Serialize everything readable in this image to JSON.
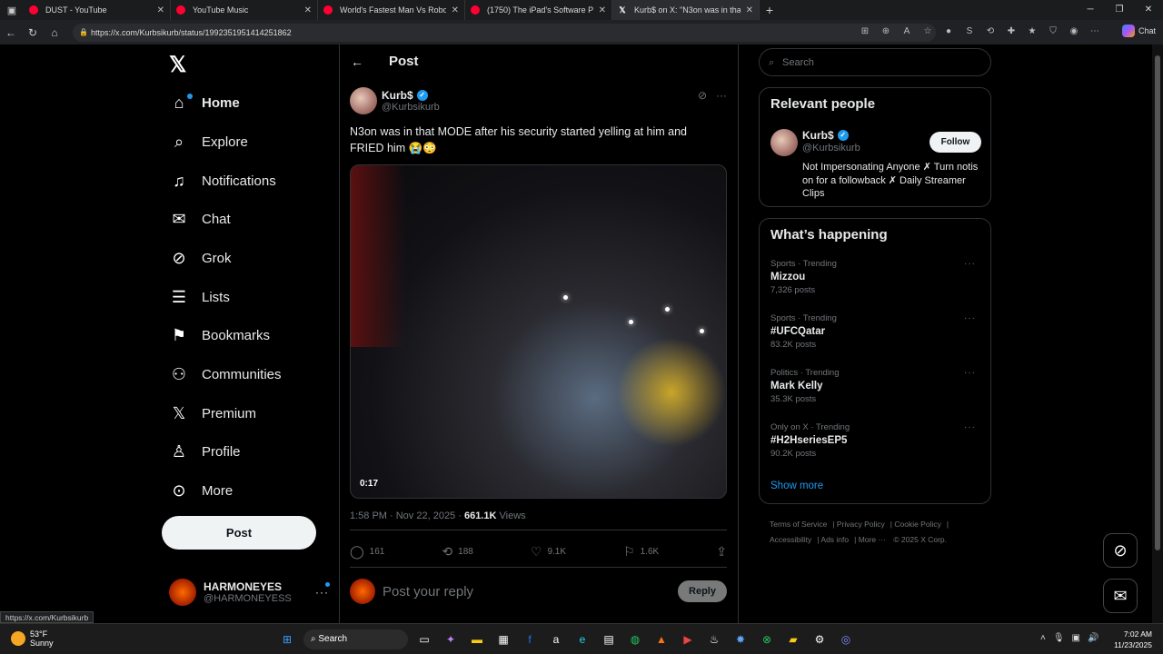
{
  "browser": {
    "tabs": [
      {
        "title": "DUST - YouTube",
        "active": false
      },
      {
        "title": "YouTube Music",
        "active": false
      },
      {
        "title": "World's Fastest Man Vs Robot! - Y",
        "active": false
      },
      {
        "title": "(1750) The iPad's Software Proble",
        "active": false
      },
      {
        "title": "Kurb$ on X: \"N3on was in that M",
        "active": true
      }
    ],
    "url": "https://x.com/Kurbsikurb/status/1992351951414251862",
    "chat_label": "Chat"
  },
  "nav": {
    "logo": "𝕏",
    "items": [
      {
        "label": "Home",
        "icon": "home-icon",
        "glyph": "⌂"
      },
      {
        "label": "Explore",
        "icon": "search-icon",
        "glyph": "⌕"
      },
      {
        "label": "Notifications",
        "icon": "bell-icon",
        "glyph": "🔔"
      },
      {
        "label": "Chat",
        "icon": "mail-icon",
        "glyph": "✉"
      },
      {
        "label": "Grok",
        "icon": "grok-icon",
        "glyph": "⊘"
      },
      {
        "label": "Lists",
        "icon": "list-icon",
        "glyph": "☰"
      },
      {
        "label": "Bookmarks",
        "icon": "bookmark-icon",
        "glyph": "🔖"
      },
      {
        "label": "Communities",
        "icon": "people-icon",
        "glyph": "👥"
      },
      {
        "label": "Premium",
        "icon": "x-icon",
        "glyph": "𝕏"
      },
      {
        "label": "Profile",
        "icon": "person-icon",
        "glyph": "👤"
      },
      {
        "label": "More",
        "icon": "more-circle-icon",
        "glyph": "⋯"
      }
    ],
    "post_button": "Post",
    "account": {
      "name": "HARMONEYES",
      "handle": "@HARMONEYESS"
    }
  },
  "main": {
    "header_title": "Post",
    "author": {
      "name": "Kurb$",
      "handle": "@Kurbsikurb"
    },
    "text": "N3on was in that MODE after his security started yelling at him and FRIED him 😭😳",
    "video_duration": "0:17",
    "timestamp": "1:58 PM · Nov 22, 2025 · ",
    "views_count": "661.1K",
    "views_label": " Views",
    "actions": {
      "replies": "161",
      "reposts": "188",
      "likes": "9.1K",
      "bookmarks": "1.6K"
    },
    "reply_placeholder": "Post your reply",
    "reply_button": "Reply"
  },
  "sidebar": {
    "search_placeholder": "Search",
    "relevant_title": "Relevant people",
    "person": {
      "name": "Kurb$",
      "handle": "@Kurbsikurb",
      "follow": "Follow",
      "bio": "Not Impersonating Anyone ✗ Turn notis on for a followback ✗ Daily Streamer Clips"
    },
    "happening_title": "What’s happening",
    "trends": [
      {
        "category": "Sports · Trending",
        "name": "Mizzou",
        "count": "7,326 posts"
      },
      {
        "category": "Sports · Trending",
        "name": "#UFCQatar",
        "count": "83.2K posts"
      },
      {
        "category": "Politics · Trending",
        "name": "Mark Kelly",
        "count": "35.3K posts"
      },
      {
        "category": "Only on X · Trending",
        "name": "#H2HseriesEP5",
        "count": "90.2K posts"
      }
    ],
    "show_more": "Show more",
    "footer_links": [
      "Terms of Service",
      "Privacy Policy",
      "Cookie Policy",
      "Accessibility",
      "Ads info",
      "More ···",
      "© 2025 X Corp."
    ]
  },
  "status_url": "https://x.com/Kurbsikurb",
  "taskbar": {
    "temp": "53°F",
    "condition": "Sunny",
    "search_label": "Search",
    "time": "7:02 AM",
    "date": "11/23/2025"
  }
}
